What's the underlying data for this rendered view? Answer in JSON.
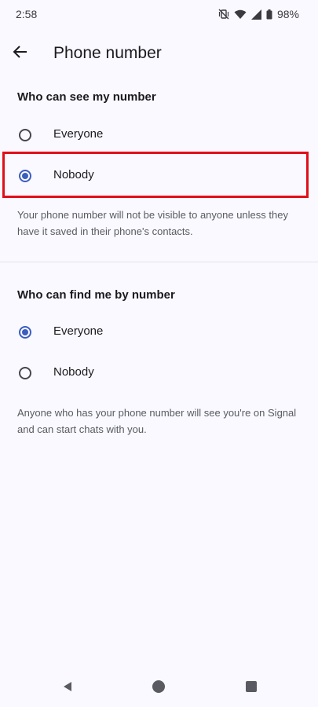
{
  "status_bar": {
    "time": "2:58",
    "battery": "98%"
  },
  "app_bar": {
    "title": "Phone number"
  },
  "see_section": {
    "header": "Who can see my number",
    "options": [
      {
        "label": "Everyone",
        "selected": false
      },
      {
        "label": "Nobody",
        "selected": true
      }
    ],
    "description": "Your phone number will not be visible to anyone unless they have it saved in their phone's contacts."
  },
  "find_section": {
    "header": "Who can find me by number",
    "options": [
      {
        "label": "Everyone",
        "selected": true
      },
      {
        "label": "Nobody",
        "selected": false
      }
    ],
    "description": "Anyone who has your phone number will see you're on Signal and can start chats with you."
  },
  "colors": {
    "accent": "#3c5ebf",
    "highlight": "#e0101a",
    "background": "#f9f9ff"
  },
  "icons": {
    "back": "arrow-left-icon",
    "nav_back": "triangle-back-icon",
    "nav_home": "circle-home-icon",
    "nav_recents": "square-recents-icon"
  }
}
